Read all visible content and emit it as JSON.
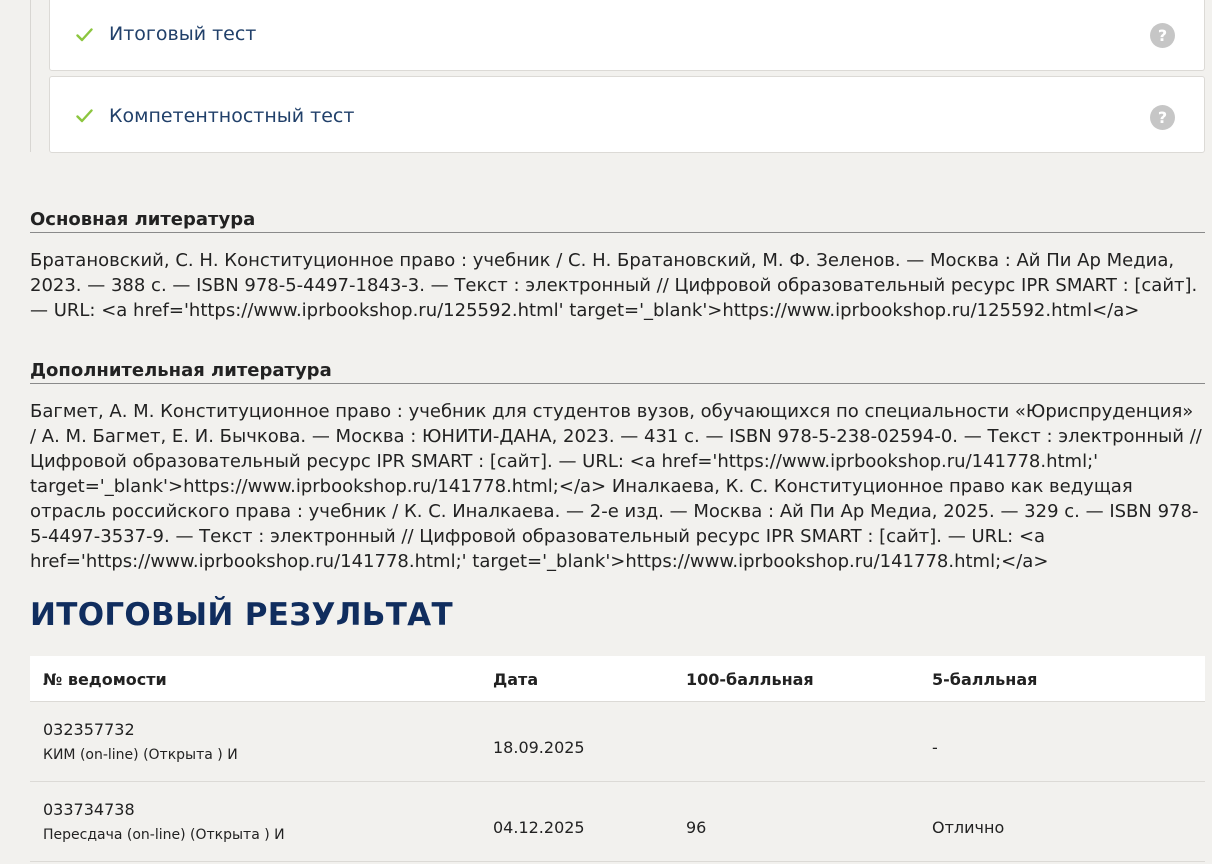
{
  "tests": [
    {
      "title": "Итоговый тест",
      "help": "?"
    },
    {
      "title": "Компетентностный тест",
      "help": "?"
    }
  ],
  "literature": {
    "main_heading": "Основная литература",
    "main_text": "Братановский, С. Н. Конституционное право : учебник / С. Н. Братановский, М. Ф. Зеленов. — Москва : Ай Пи Ар Медиа, 2023. — 388 с. — ISBN 978-5-4497-1843-3. — Текст : электронный // Цифровой образовательный ресурс IPR SMART : [сайт]. — URL: <a href='https://www.iprbookshop.ru/125592.html' target='_blank'>https://www.iprbookshop.ru/125592.html</a>",
    "extra_heading": "Дополнительная литература",
    "extra_text": "Багмет, А. М. Конституционное право : учебник для студентов вузов, обучающихся по специальности «Юриспруденция» / А. М. Багмет, Е. И. Бычкова. — Москва : ЮНИТИ-ДАНА, 2023. — 431 с. — ISBN 978-5-238-02594-0. — Текст : электронный // Цифровой образовательный ресурс IPR SMART : [сайт]. — URL: <a href='https://www.iprbookshop.ru/141778.html;' target='_blank'>https://www.iprbookshop.ru/141778.html;</a> Иналкаева, К. С. Конституционное право как ведущая отрасль российского права : учебник / К. С. Иналкаева. — 2-е изд. — Москва : Ай Пи Ар Медиа, 2025. — 329 с. — ISBN 978-5-4497-3537-9. — Текст : электронный // Цифровой образовательный ресурс IPR SMART : [сайт]. — URL: <a href='https://www.iprbookshop.ru/141778.html;' target='_blank'>https://www.iprbookshop.ru/141778.html;</a>"
  },
  "result": {
    "heading": "ИТОГОВЫЙ РЕЗУЛЬТАТ",
    "columns": [
      "№ ведомости",
      "Дата",
      "100-балльная",
      "5-балльная"
    ],
    "rows": [
      {
        "number": "032357732",
        "type": "КИМ (on-line) (Открыта ) И",
        "date": "18.09.2025",
        "score100": "",
        "score5": "-"
      },
      {
        "number": "033734738",
        "type": "Пересдача (on-line) (Открыта ) И",
        "date": "04.12.2025",
        "score100": "96",
        "score5": "Отлично"
      }
    ]
  },
  "colors": {
    "check": "#8cc63f",
    "test_title": "#21406a",
    "result_heading": "#102d5e",
    "background": "#f2f1ee"
  }
}
